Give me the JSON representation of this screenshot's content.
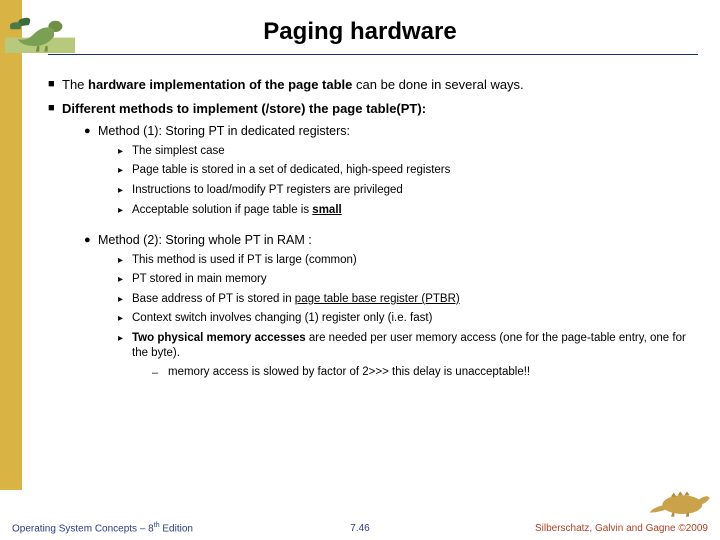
{
  "title": "Paging hardware",
  "bullets": {
    "b1_pre": "The ",
    "b1_bold": "hardware implementation of the page table",
    "b1_post": " can be done in several ways.",
    "b2": "Different methods to implement (/store) the page table(PT):",
    "m1_title": "Method (1): Storing PT in dedicated registers:",
    "m1_i1": "The simplest case",
    "m1_i2": "Page table is stored in a set of dedicated, high-speed registers",
    "m1_i3": "Instructions to load/modify PT registers are privileged",
    "m1_i4_pre": "Acceptable solution if page table is ",
    "m1_i4_u": "small",
    "m2_title": "Method (2): Storing whole PT in RAM  :",
    "m2_i1": "This method is used if PT is large (common)",
    "m2_i2": "PT stored in main memory",
    "m2_i3_pre": "Base address of PT is stored in ",
    "m2_i3_u": "page table base register (PTBR)",
    "m2_i4": "Context switch involves changing (1) register only (i.e. fast)",
    "m2_i5_bold": "Two physical memory accesses",
    "m2_i5_post": " are needed per user memory access (one for the page-table entry, one for the byte).",
    "m2_i5_sub": "memory access is slowed by factor of 2>>> this delay is unacceptable!!"
  },
  "footer": {
    "left_pre": "Operating System Concepts – 8",
    "left_sup": "th",
    "left_post": " Edition",
    "center": "7.46",
    "right": "Silberschatz, Galvin and Gagne ©2009"
  },
  "icons": {
    "square": "■",
    "disc": "●",
    "tri": "▸",
    "dash": "–"
  }
}
